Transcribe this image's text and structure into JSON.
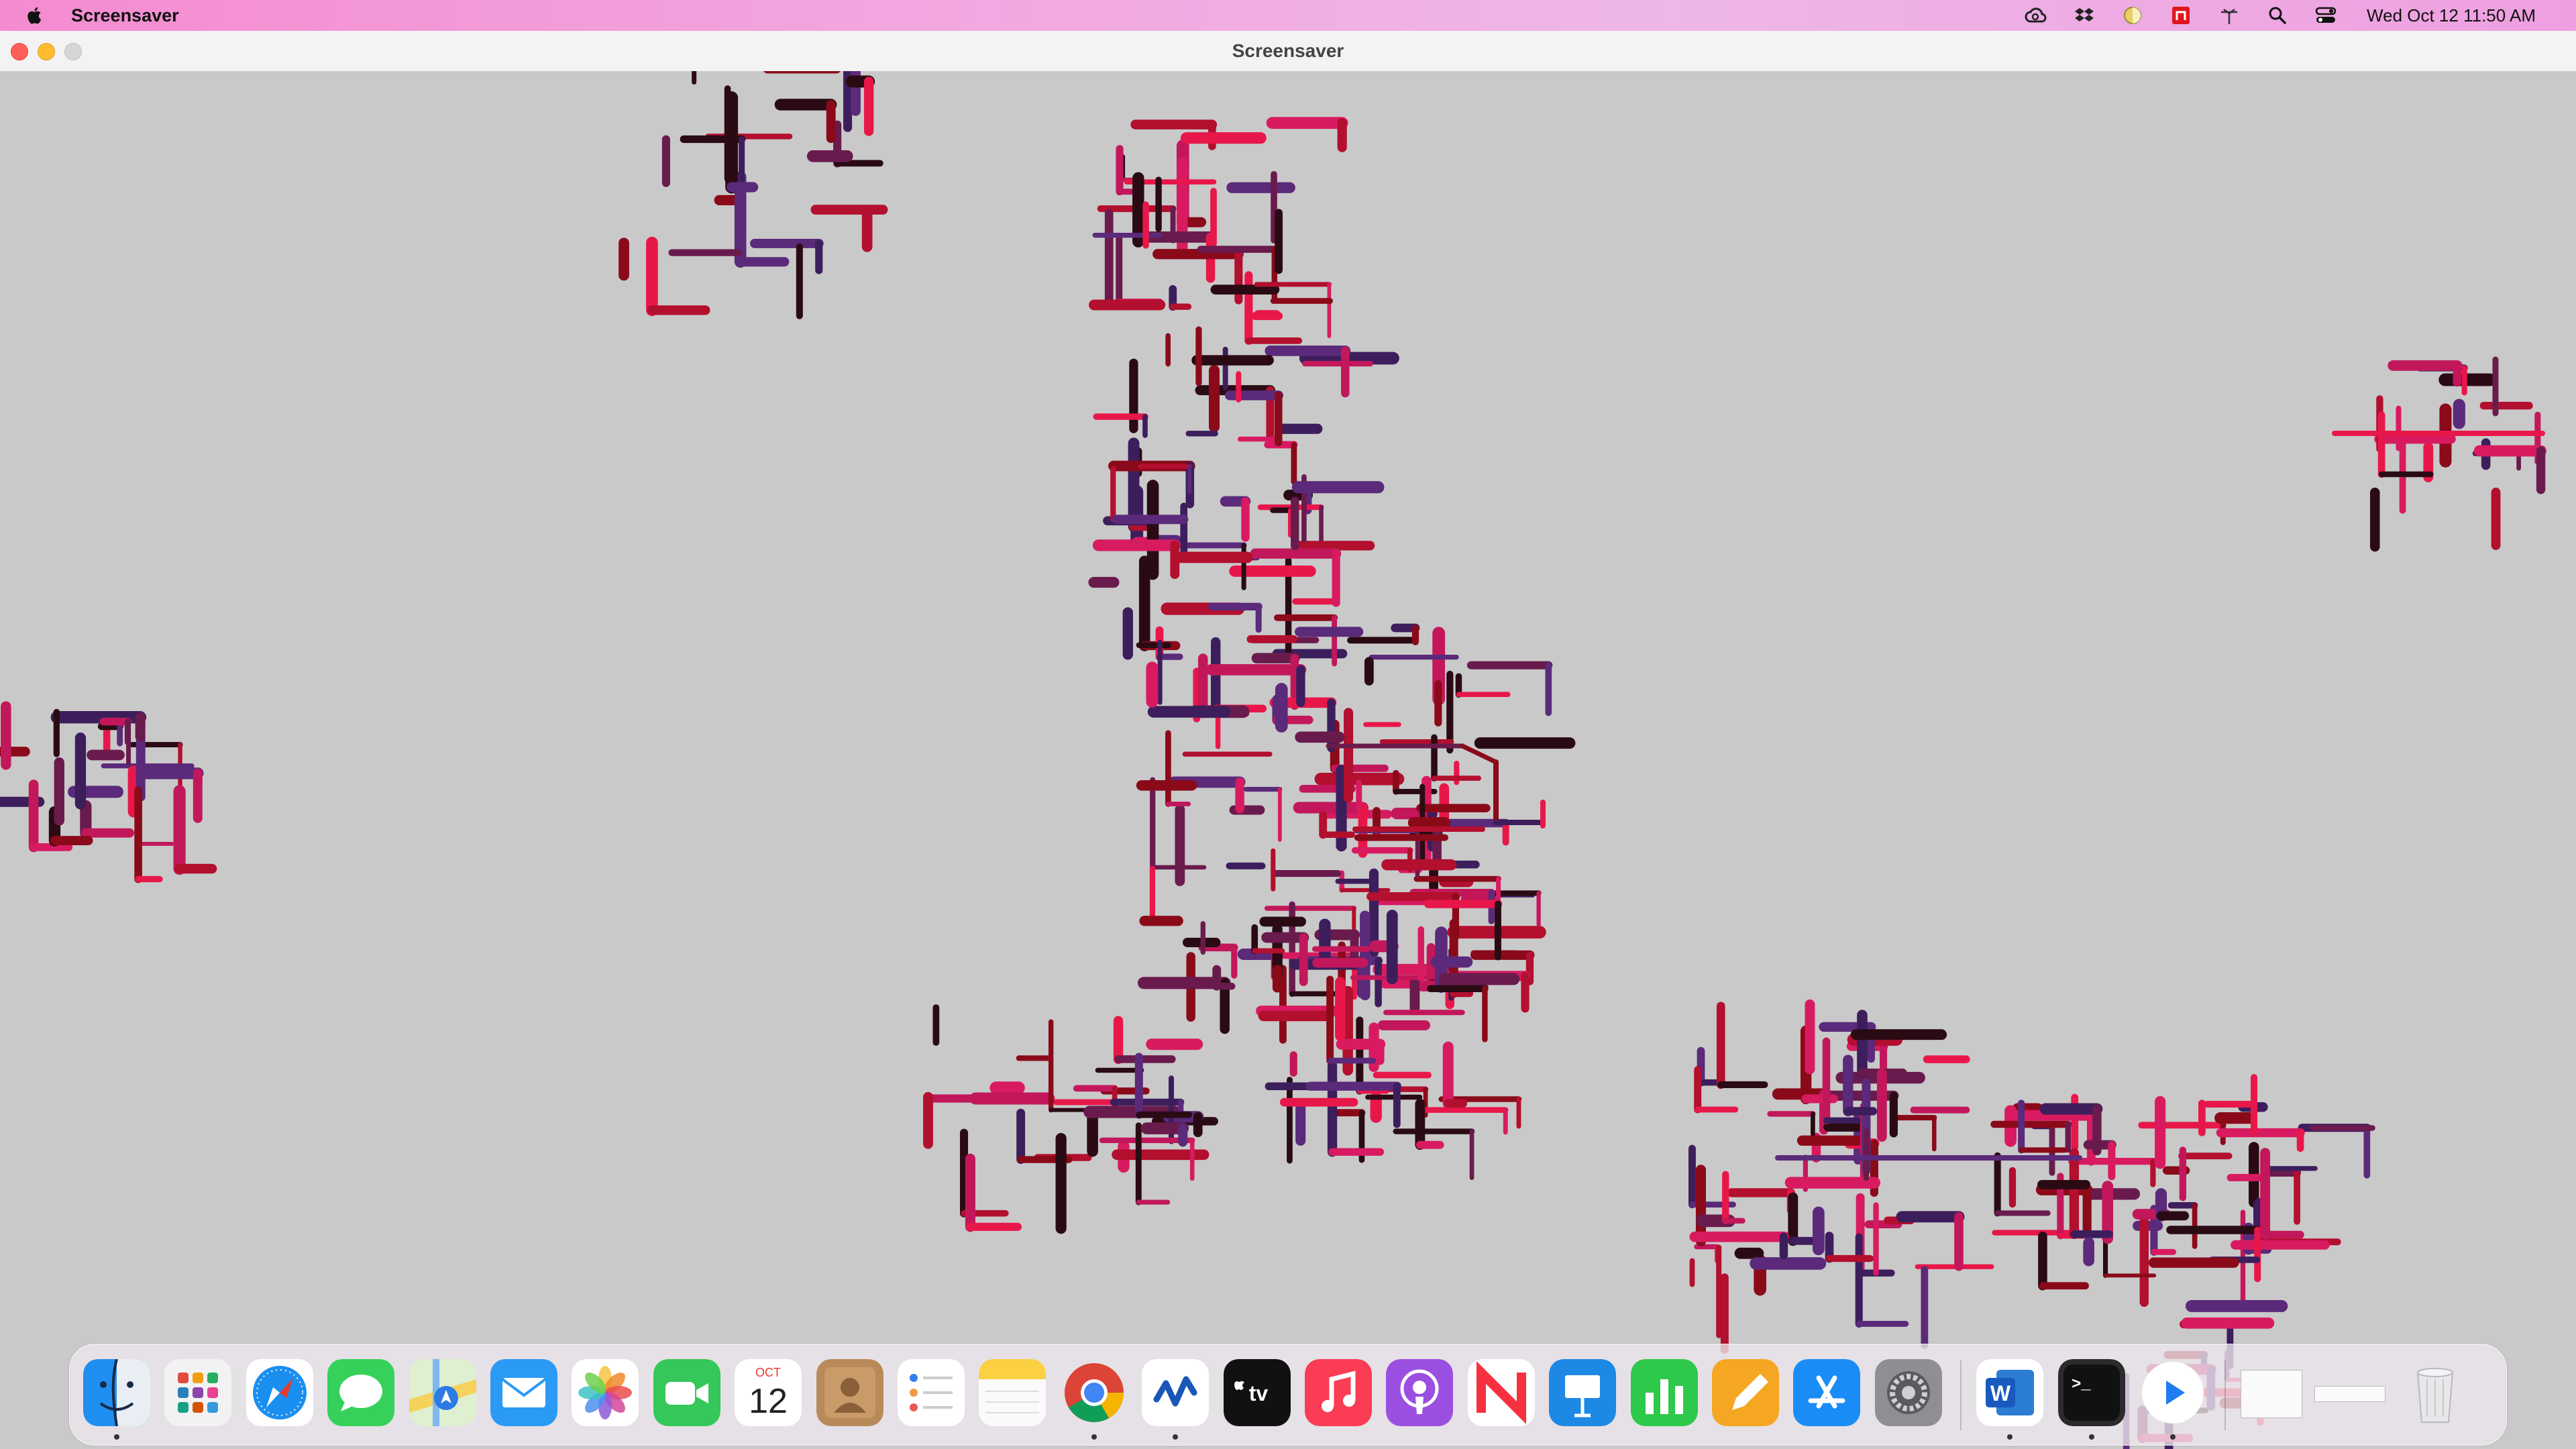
{
  "menubar": {
    "app_name": "Screensaver",
    "clock": "Wed Oct 12  11:50 AM",
    "status_icons": [
      "creative-cloud-icon",
      "dropbox-icon",
      "toggle-app-icon",
      "adobe-acrobat-icon",
      "wifi-antenna-icon",
      "search-icon",
      "control-center-icon"
    ]
  },
  "window": {
    "title": "Screensaver"
  },
  "dock": {
    "apps": [
      {
        "name": "Finder",
        "icon": "finder-icon",
        "running": true
      },
      {
        "name": "Launchpad",
        "icon": "launchpad-icon",
        "running": false
      },
      {
        "name": "Safari",
        "icon": "safari-icon",
        "running": false
      },
      {
        "name": "Messages",
        "icon": "messages-icon",
        "running": false
      },
      {
        "name": "Maps",
        "icon": "maps-icon",
        "running": false
      },
      {
        "name": "Mail",
        "icon": "mail-icon",
        "running": false
      },
      {
        "name": "Photos",
        "icon": "photos-icon",
        "running": false
      },
      {
        "name": "FaceTime",
        "icon": "facetime-icon",
        "running": false
      },
      {
        "name": "Calendar",
        "icon": "calendar-icon",
        "running": false
      },
      {
        "name": "Contacts",
        "icon": "contacts-icon",
        "running": false
      },
      {
        "name": "Reminders",
        "icon": "reminders-icon",
        "running": false
      },
      {
        "name": "Notes",
        "icon": "notes-icon",
        "running": false
      },
      {
        "name": "Google Chrome",
        "icon": "chrome-icon",
        "running": true
      },
      {
        "name": "Pulse Secure",
        "icon": "pulse-icon",
        "running": true
      },
      {
        "name": "Apple TV",
        "icon": "apple-tv-icon",
        "running": false
      },
      {
        "name": "Music",
        "icon": "music-icon",
        "running": false
      },
      {
        "name": "Podcasts",
        "icon": "podcasts-icon",
        "running": false
      },
      {
        "name": "News",
        "icon": "news-icon",
        "running": false
      },
      {
        "name": "Keynote",
        "icon": "keynote-icon",
        "running": false
      },
      {
        "name": "Numbers",
        "icon": "numbers-icon",
        "running": false
      },
      {
        "name": "Pages",
        "icon": "pages-icon",
        "running": false
      },
      {
        "name": "App Store",
        "icon": "app-store-icon",
        "running": false
      },
      {
        "name": "System Preferences",
        "icon": "system-preferences-icon",
        "running": false
      },
      {
        "name": "Microsoft Word",
        "icon": "word-icon",
        "running": true
      },
      {
        "name": "Terminal",
        "icon": "terminal-icon",
        "running": true
      },
      {
        "name": "Screensaver",
        "icon": "play-icon",
        "running": true
      }
    ],
    "calendar": {
      "month": "OCT",
      "day": "12"
    },
    "tv_label": "tv",
    "terminal_prompt": ">_",
    "word_letter": "W"
  },
  "colors": {
    "accent_pink": "#f48bd0",
    "pipe_colors": [
      "#e8174a",
      "#c2185b",
      "#6a1b4d",
      "#3d1e5c",
      "#8b0a1a",
      "#2a0b14",
      "#d81b60",
      "#b30f2e",
      "#5b2a7a"
    ]
  }
}
